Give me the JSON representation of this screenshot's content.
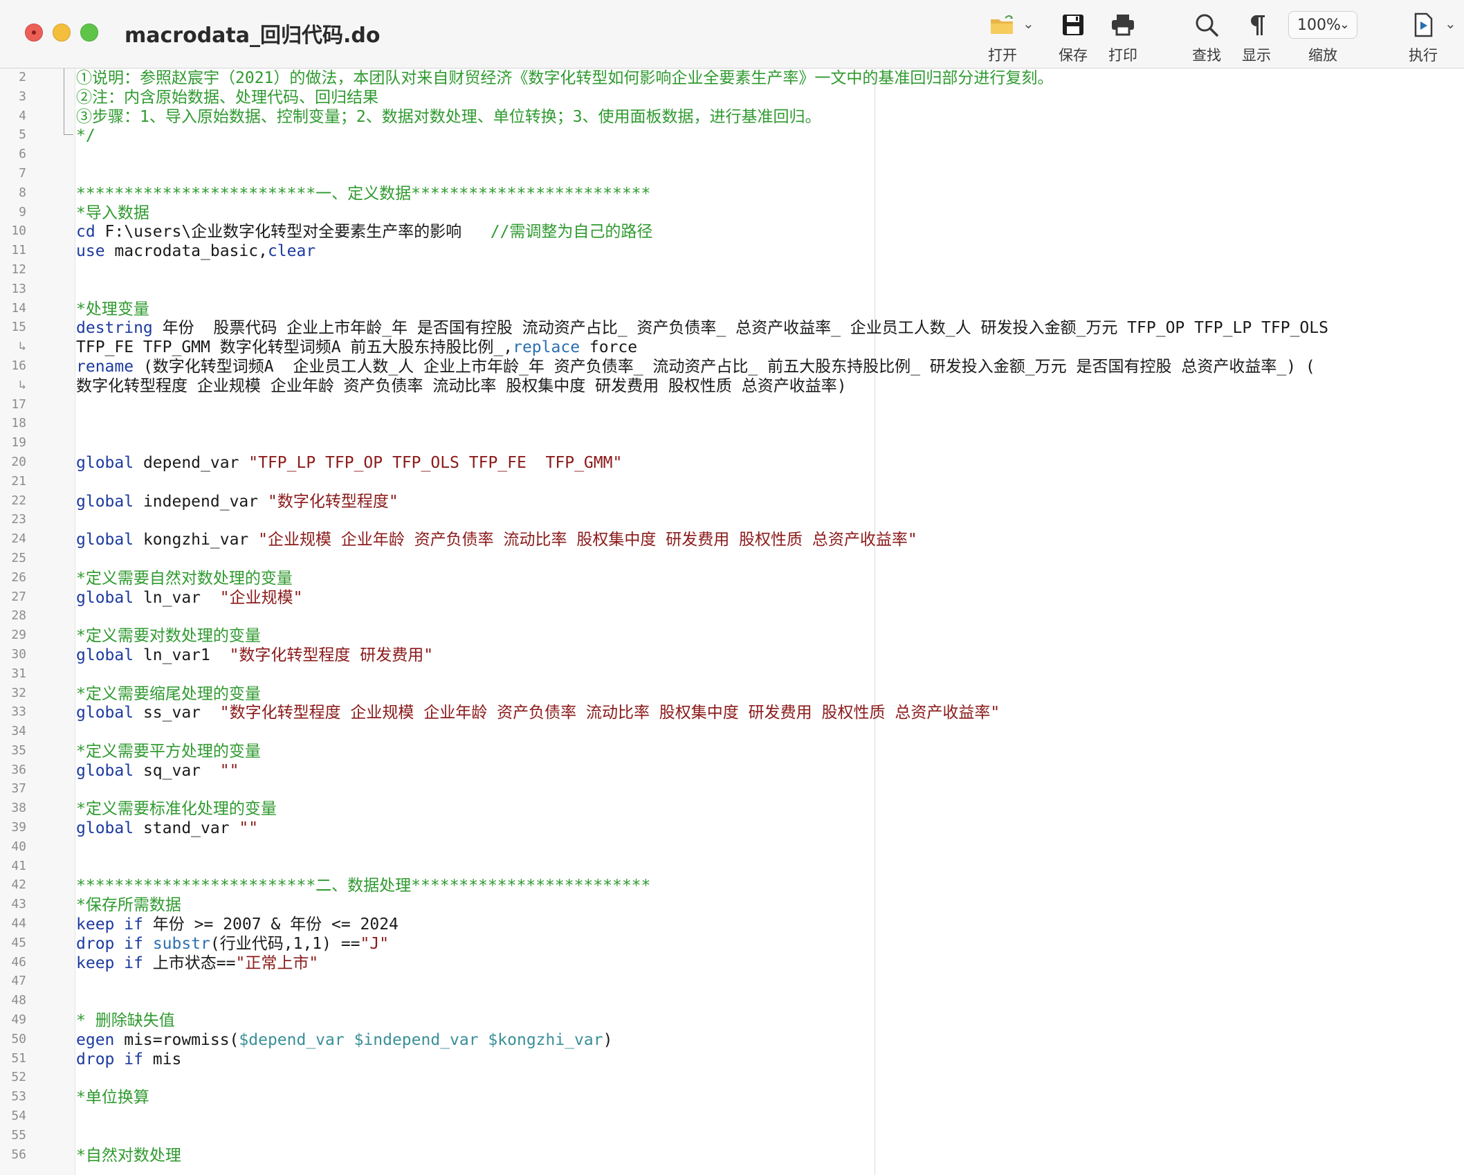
{
  "window": {
    "title": "macrodata_回归代码.do"
  },
  "toolbar": {
    "open": {
      "label": "打开",
      "icon": "folder-open-icon"
    },
    "save": {
      "label": "保存",
      "icon": "save-icon"
    },
    "print": {
      "label": "打印",
      "icon": "print-icon"
    },
    "find": {
      "label": "查找",
      "icon": "search-icon"
    },
    "show": {
      "label": "显示",
      "icon": "pilcrow-icon"
    },
    "zoom": {
      "label": "缩放",
      "value": "100%"
    },
    "run": {
      "label": "执行",
      "icon": "run-icon"
    }
  },
  "colors": {
    "comment": "#2f9a2f",
    "keyword": "#1c3a9e",
    "string": "#8b1a1a",
    "function": "#2b6fb0",
    "global_ref": "#3a8f99"
  },
  "lines": [
    {
      "n": "2",
      "segs": [
        {
          "t": "①说明：参照赵宸宇（2021）的做法，本团队对来自财贸经济《数字化转型如何影响企业全要素生产率》一文中的基准回归部分进行复刻。",
          "c": "cm"
        }
      ]
    },
    {
      "n": "3",
      "segs": [
        {
          "t": "②注：内含原始数据、处理代码、回归结果",
          "c": "cm"
        }
      ]
    },
    {
      "n": "4",
      "segs": [
        {
          "t": "③步骤：1、导入原始数据、控制变量；2、数据对数处理、单位转换；3、使用面板数据，进行基准回归。",
          "c": "cm"
        }
      ]
    },
    {
      "n": "5",
      "segs": [
        {
          "t": "*/",
          "c": "cm"
        }
      ]
    },
    {
      "n": "6",
      "segs": []
    },
    {
      "n": "7",
      "segs": []
    },
    {
      "n": "8",
      "segs": [
        {
          "t": "*************************一、定义数据*************************",
          "c": "cm"
        }
      ]
    },
    {
      "n": "9",
      "segs": [
        {
          "t": "*导入数据",
          "c": "cm"
        }
      ]
    },
    {
      "n": "10",
      "segs": [
        {
          "t": "cd",
          "c": "kw"
        },
        {
          "t": " F:\\users\\企业数字化转型对全要素生产率的影响   ",
          "c": "pl"
        },
        {
          "t": "//需调整为自己的路径",
          "c": "cm"
        }
      ]
    },
    {
      "n": "11",
      "segs": [
        {
          "t": "use",
          "c": "kw"
        },
        {
          "t": " macrodata_basic,",
          "c": "pl"
        },
        {
          "t": "clear",
          "c": "kw"
        }
      ]
    },
    {
      "n": "12",
      "segs": []
    },
    {
      "n": "13",
      "segs": []
    },
    {
      "n": "14",
      "segs": [
        {
          "t": "*处理变量",
          "c": "cm"
        }
      ]
    },
    {
      "n": "15",
      "segs": [
        {
          "t": "destring",
          "c": "kw"
        },
        {
          "t": " 年份  股票代码 企业上市年龄_年 是否国有控股 流动资产占比_ 资产负债率_ 总资产收益率_ 企业员工人数_人 研发投入金额_万元 TFP_OP TFP_LP TFP_OLS",
          "c": "pl"
        }
      ]
    },
    {
      "n": "↳",
      "segs": [
        {
          "t": "TFP_FE TFP_GMM 数字化转型词频A 前五大股东持股比例_,",
          "c": "pl"
        },
        {
          "t": "replace",
          "c": "fn"
        },
        {
          "t": " force",
          "c": "pl"
        }
      ]
    },
    {
      "n": "16",
      "segs": [
        {
          "t": "rename",
          "c": "kw"
        },
        {
          "t": " (数字化转型词频A  企业员工人数_人 企业上市年龄_年 资产负债率_ 流动资产占比_ 前五大股东持股比例_ 研发投入金额_万元 是否国有控股 总资产收益率_) (",
          "c": "pl"
        }
      ]
    },
    {
      "n": "↳",
      "segs": [
        {
          "t": "数字化转型程度 企业规模 企业年龄 资产负债率 流动比率 股权集中度 研发费用 股权性质 总资产收益率)",
          "c": "pl"
        }
      ]
    },
    {
      "n": "17",
      "segs": []
    },
    {
      "n": "18",
      "segs": []
    },
    {
      "n": "19",
      "segs": []
    },
    {
      "n": "20",
      "segs": [
        {
          "t": "global",
          "c": "kw"
        },
        {
          "t": " depend_var ",
          "c": "pl"
        },
        {
          "t": "\"TFP_LP TFP_OP TFP_OLS TFP_FE  TFP_GMM\"",
          "c": "st"
        }
      ]
    },
    {
      "n": "21",
      "segs": []
    },
    {
      "n": "22",
      "segs": [
        {
          "t": "global",
          "c": "kw"
        },
        {
          "t": " independ_var ",
          "c": "pl"
        },
        {
          "t": "\"数字化转型程度\"",
          "c": "st"
        }
      ]
    },
    {
      "n": "23",
      "segs": []
    },
    {
      "n": "24",
      "segs": [
        {
          "t": "global",
          "c": "kw"
        },
        {
          "t": " kongzhi_var ",
          "c": "pl"
        },
        {
          "t": "\"企业规模 企业年龄 资产负债率 流动比率 股权集中度 研发费用 股权性质 总资产收益率\"",
          "c": "st"
        }
      ]
    },
    {
      "n": "25",
      "segs": []
    },
    {
      "n": "26",
      "segs": [
        {
          "t": "*定义需要自然对数处理的变量",
          "c": "cm"
        }
      ]
    },
    {
      "n": "27",
      "segs": [
        {
          "t": "global",
          "c": "kw"
        },
        {
          "t": " ln_var  ",
          "c": "pl"
        },
        {
          "t": "\"企业规模\"",
          "c": "st"
        }
      ]
    },
    {
      "n": "28",
      "segs": []
    },
    {
      "n": "29",
      "segs": [
        {
          "t": "*定义需要对数处理的变量",
          "c": "cm"
        }
      ]
    },
    {
      "n": "30",
      "segs": [
        {
          "t": "global",
          "c": "kw"
        },
        {
          "t": " ln_var1  ",
          "c": "pl"
        },
        {
          "t": "\"数字化转型程度 研发费用\"",
          "c": "st"
        }
      ]
    },
    {
      "n": "31",
      "segs": []
    },
    {
      "n": "32",
      "segs": [
        {
          "t": "*定义需要缩尾处理的变量",
          "c": "cm"
        }
      ]
    },
    {
      "n": "33",
      "segs": [
        {
          "t": "global",
          "c": "kw"
        },
        {
          "t": " ss_var  ",
          "c": "pl"
        },
        {
          "t": "\"数字化转型程度 企业规模 企业年龄 资产负债率 流动比率 股权集中度 研发费用 股权性质 总资产收益率\"",
          "c": "st"
        }
      ]
    },
    {
      "n": "34",
      "segs": []
    },
    {
      "n": "35",
      "segs": [
        {
          "t": "*定义需要平方处理的变量",
          "c": "cm"
        }
      ]
    },
    {
      "n": "36",
      "segs": [
        {
          "t": "global",
          "c": "kw"
        },
        {
          "t": " sq_var  ",
          "c": "pl"
        },
        {
          "t": "\"\"",
          "c": "st"
        }
      ]
    },
    {
      "n": "37",
      "segs": []
    },
    {
      "n": "38",
      "segs": [
        {
          "t": "*定义需要标准化处理的变量",
          "c": "cm"
        }
      ]
    },
    {
      "n": "39",
      "segs": [
        {
          "t": "global",
          "c": "kw"
        },
        {
          "t": " stand_var ",
          "c": "pl"
        },
        {
          "t": "\"\"",
          "c": "st"
        }
      ]
    },
    {
      "n": "40",
      "segs": []
    },
    {
      "n": "41",
      "segs": []
    },
    {
      "n": "42",
      "segs": [
        {
          "t": "*************************二、数据处理*************************",
          "c": "cm"
        }
      ]
    },
    {
      "n": "43",
      "segs": [
        {
          "t": "*保存所需数据",
          "c": "cm"
        }
      ]
    },
    {
      "n": "44",
      "segs": [
        {
          "t": "keep",
          "c": "kw"
        },
        {
          "t": " ",
          "c": "pl"
        },
        {
          "t": "if",
          "c": "kw"
        },
        {
          "t": " 年份 >= 2007 & 年份 <= 2024",
          "c": "pl"
        }
      ]
    },
    {
      "n": "45",
      "segs": [
        {
          "t": "drop",
          "c": "kw"
        },
        {
          "t": " ",
          "c": "pl"
        },
        {
          "t": "if",
          "c": "kw"
        },
        {
          "t": " ",
          "c": "pl"
        },
        {
          "t": "substr",
          "c": "fn"
        },
        {
          "t": "(行业代码,1,1) ==",
          "c": "pl"
        },
        {
          "t": "\"J\"",
          "c": "st"
        }
      ]
    },
    {
      "n": "46",
      "segs": [
        {
          "t": "keep",
          "c": "kw"
        },
        {
          "t": " ",
          "c": "pl"
        },
        {
          "t": "if",
          "c": "kw"
        },
        {
          "t": " 上市状态==",
          "c": "pl"
        },
        {
          "t": "\"正常上市\"",
          "c": "st"
        }
      ]
    },
    {
      "n": "47",
      "segs": []
    },
    {
      "n": "48",
      "segs": []
    },
    {
      "n": "49",
      "segs": [
        {
          "t": "* 删除缺失值",
          "c": "cm"
        }
      ]
    },
    {
      "n": "50",
      "segs": [
        {
          "t": "egen",
          "c": "kw"
        },
        {
          "t": " mis=rowmiss(",
          "c": "pl"
        },
        {
          "t": "$depend_var $independ_var $kongzhi_var",
          "c": "gv"
        },
        {
          "t": ")",
          "c": "pl"
        }
      ]
    },
    {
      "n": "51",
      "segs": [
        {
          "t": "drop",
          "c": "kw"
        },
        {
          "t": " ",
          "c": "pl"
        },
        {
          "t": "if",
          "c": "kw"
        },
        {
          "t": " mis",
          "c": "pl"
        }
      ]
    },
    {
      "n": "52",
      "segs": []
    },
    {
      "n": "53",
      "segs": [
        {
          "t": "*单位换算",
          "c": "cm"
        }
      ]
    },
    {
      "n": "54",
      "segs": []
    },
    {
      "n": "55",
      "segs": []
    },
    {
      "n": "56",
      "segs": [
        {
          "t": "*自然对数处理",
          "c": "cm"
        }
      ]
    }
  ]
}
